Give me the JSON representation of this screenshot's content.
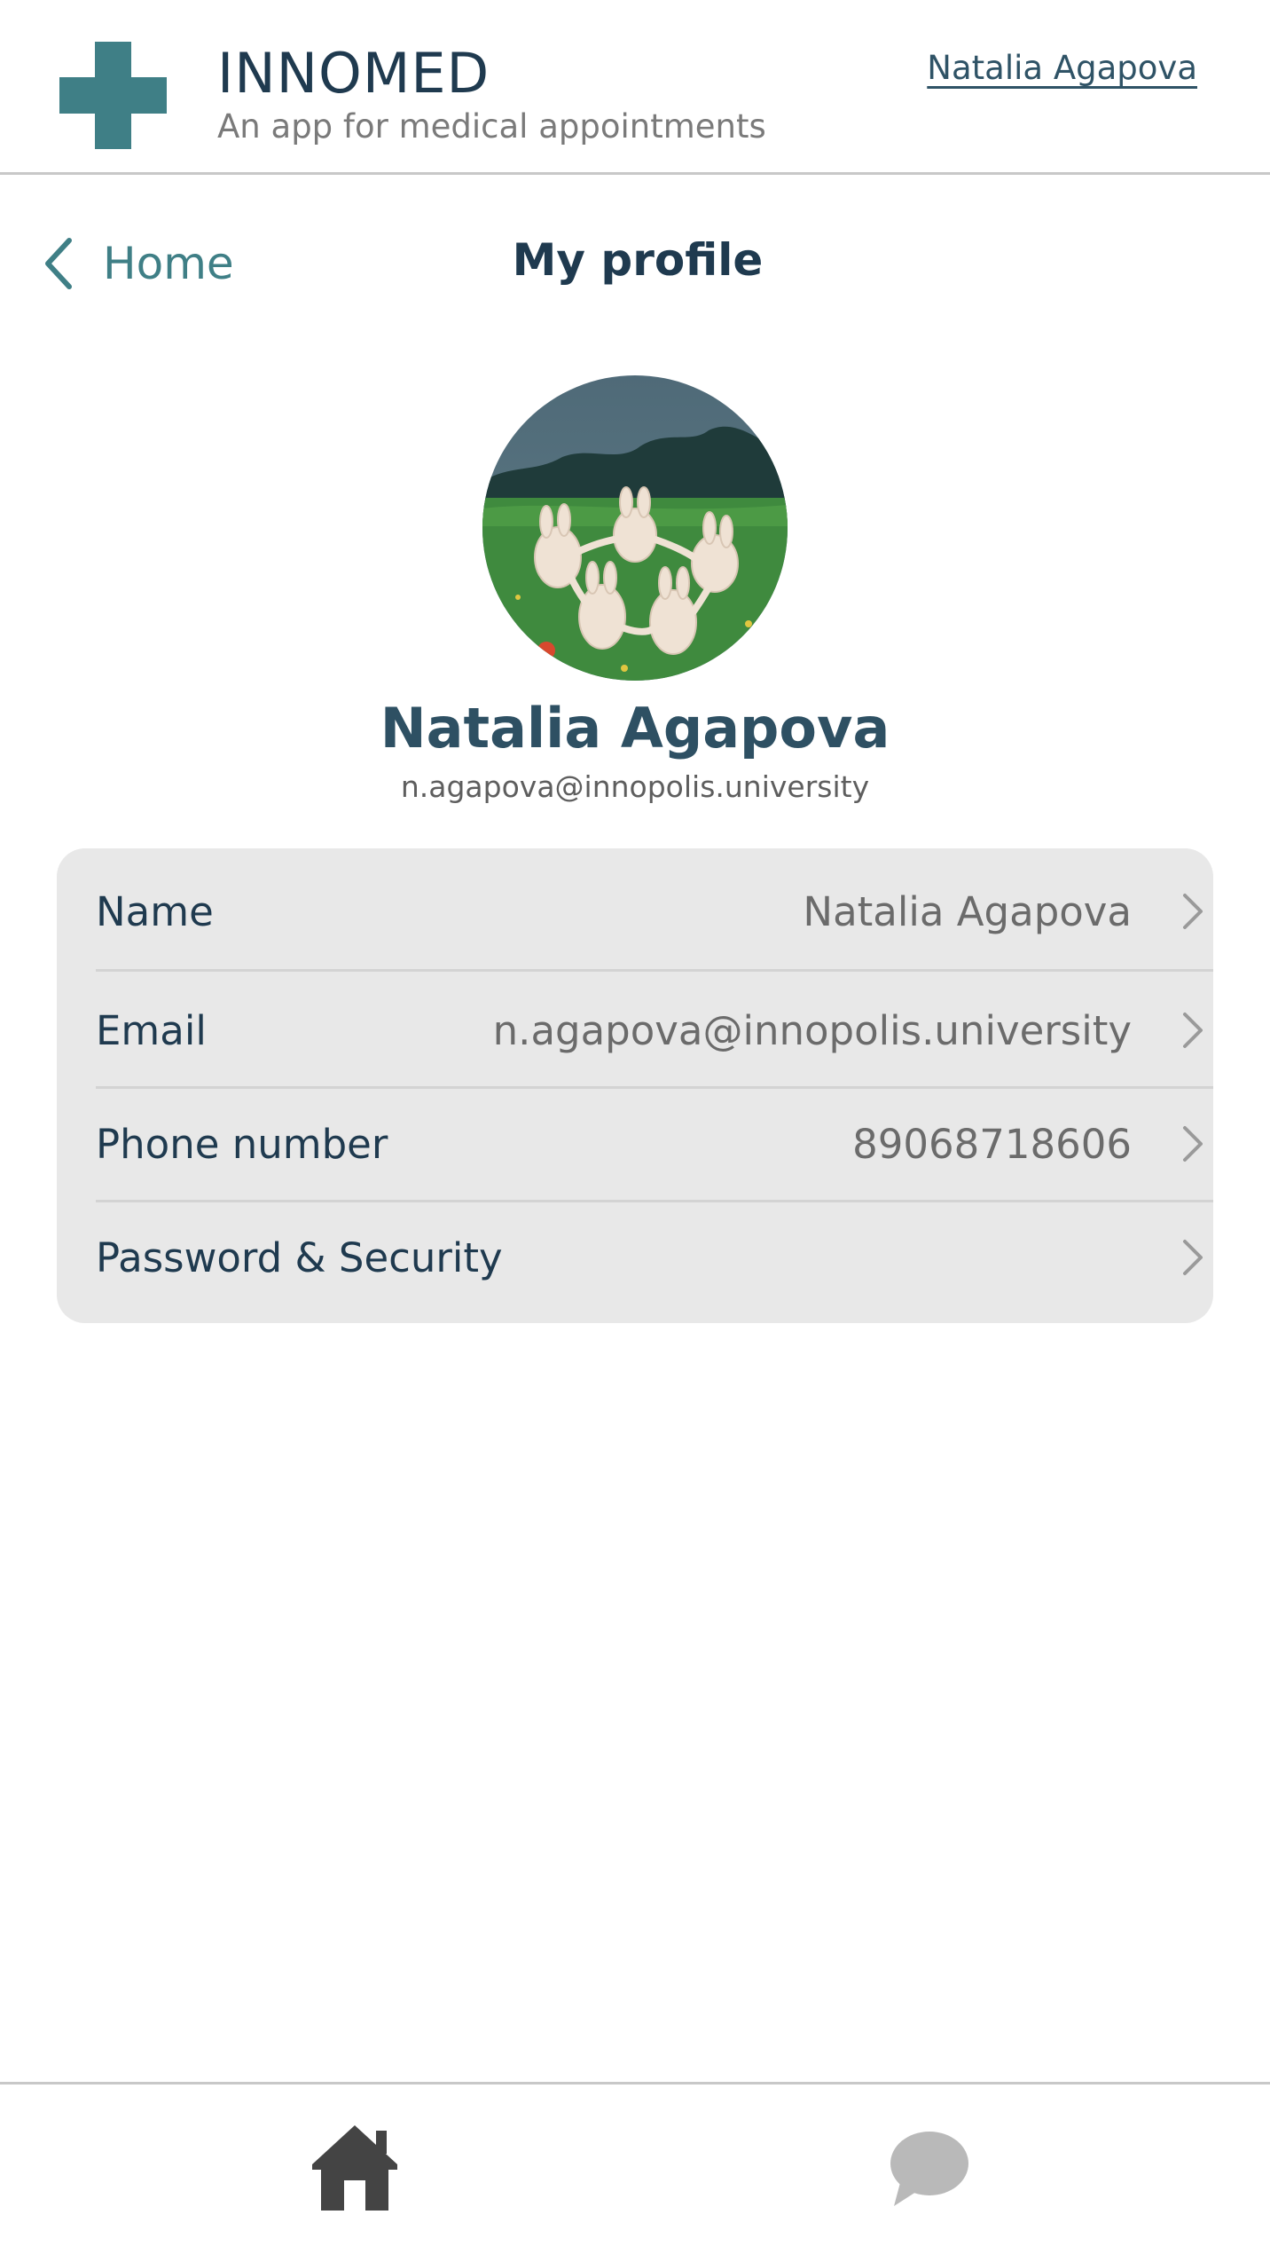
{
  "header": {
    "app_name": "INNOMED",
    "tagline": "An app for medical appointments",
    "user_link": "Natalia Agapova",
    "logo_icon": "medical-cross-icon",
    "brand_color": "#3f7f86"
  },
  "nav": {
    "back_label": "Home",
    "back_icon": "chevron-left-icon",
    "title": "My profile"
  },
  "profile": {
    "name": "Natalia Agapova",
    "email": "n.agapova@innopolis.university",
    "avatar_description_icon": "avatar-image"
  },
  "settings": {
    "rows": [
      {
        "label": "Name",
        "value": "Natalia Agapova"
      },
      {
        "label": "Email",
        "value": "n.agapova@innopolis.university"
      },
      {
        "label": "Phone number",
        "value": "89068718606"
      },
      {
        "label": "Password & Security",
        "value": ""
      }
    ],
    "chevron_icon": "chevron-right-icon"
  },
  "tabbar": {
    "items": [
      {
        "icon": "home-icon",
        "active": true
      },
      {
        "icon": "chat-bubble-icon",
        "active": false
      }
    ]
  }
}
